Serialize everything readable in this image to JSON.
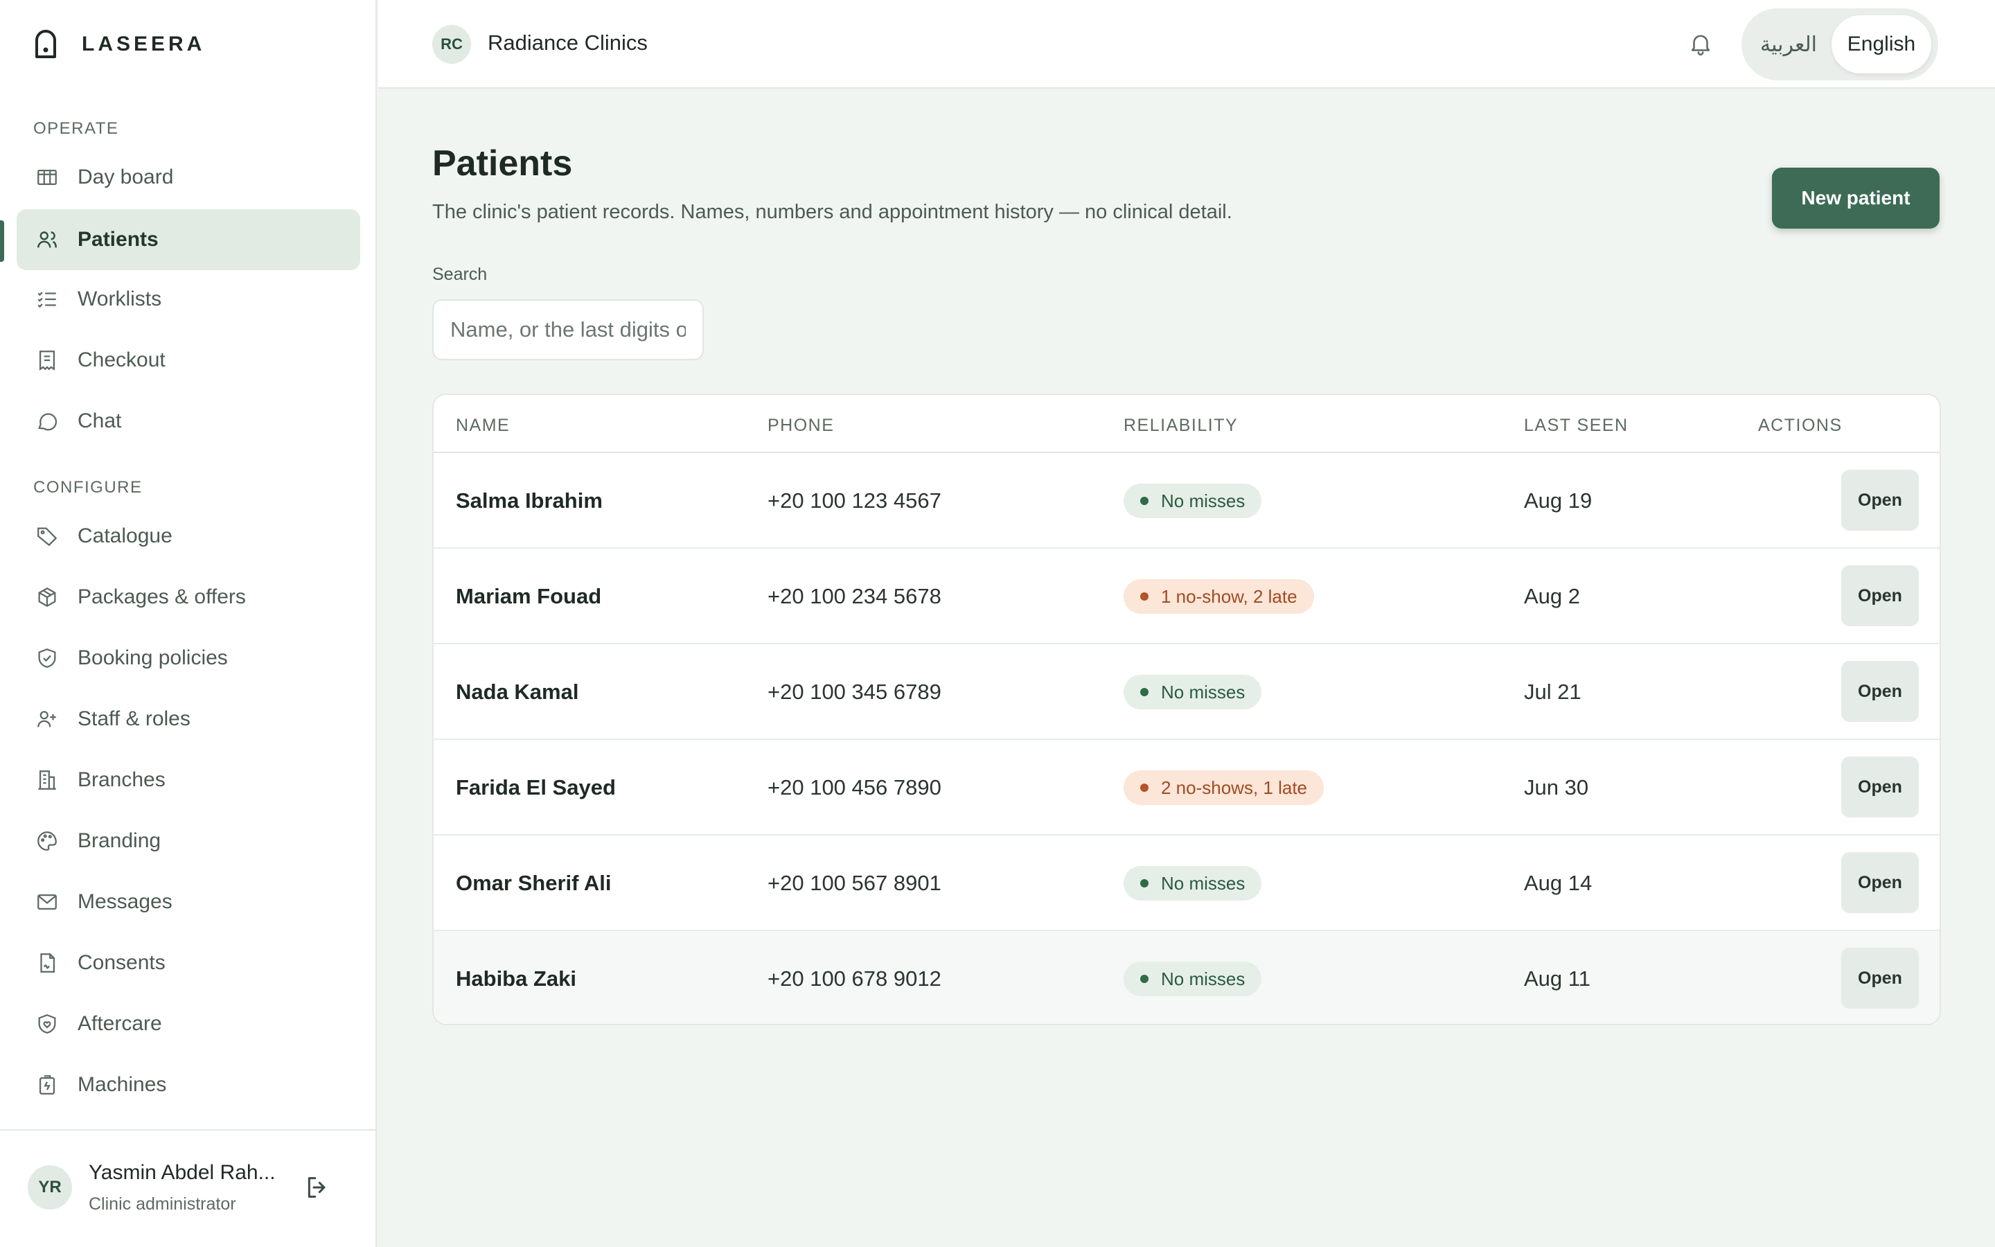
{
  "brand": {
    "name": "LASEERA"
  },
  "sidebar": {
    "sections": [
      {
        "label": "OPERATE",
        "items": [
          {
            "label": "Day board",
            "icon": "board-icon"
          },
          {
            "label": "Patients",
            "icon": "users-icon",
            "active": true
          },
          {
            "label": "Worklists",
            "icon": "list-check-icon"
          },
          {
            "label": "Checkout",
            "icon": "receipt-icon"
          },
          {
            "label": "Chat",
            "icon": "chat-icon"
          }
        ]
      },
      {
        "label": "CONFIGURE",
        "items": [
          {
            "label": "Catalogue",
            "icon": "tag-icon"
          },
          {
            "label": "Packages & offers",
            "icon": "package-icon"
          },
          {
            "label": "Booking policies",
            "icon": "shield-check-icon"
          },
          {
            "label": "Staff & roles",
            "icon": "user-plus-icon"
          },
          {
            "label": "Branches",
            "icon": "building-icon"
          },
          {
            "label": "Branding",
            "icon": "palette-icon"
          },
          {
            "label": "Messages",
            "icon": "mail-icon"
          },
          {
            "label": "Consents",
            "icon": "file-signature-icon"
          },
          {
            "label": "Aftercare",
            "icon": "heart-shield-icon"
          },
          {
            "label": "Machines",
            "icon": "laser-machine-icon"
          }
        ]
      }
    ],
    "user": {
      "initials": "YR",
      "name": "Yasmin Abdel Rah...",
      "role": "Clinic administrator"
    }
  },
  "topbar": {
    "clinic_initials": "RC",
    "clinic_name": "Radiance Clinics",
    "languages": {
      "arabic": "العربية",
      "english": "English",
      "selected": "English"
    }
  },
  "main": {
    "title": "Patients",
    "subtitle": "The clinic's patient records. Names, numbers and appointment history — no clinical detail.",
    "new_button": "New patient",
    "search": {
      "label": "Search",
      "placeholder": "Name, or the last digits of a phone",
      "value": ""
    },
    "table": {
      "columns": [
        "NAME",
        "PHONE",
        "RELIABILITY",
        "LAST SEEN",
        "ACTIONS"
      ],
      "action_label": "Open",
      "rows": [
        {
          "name": "Salma Ibrahim",
          "phone": "+20 100 123 4567",
          "reliability": "No misses",
          "status": "good",
          "last_seen": "Aug 19"
        },
        {
          "name": "Mariam Fouad",
          "phone": "+20 100 234 5678",
          "reliability": "1 no-show, 2 late",
          "status": "warn",
          "last_seen": "Aug 2"
        },
        {
          "name": "Nada Kamal",
          "phone": "+20 100 345 6789",
          "reliability": "No misses",
          "status": "good",
          "last_seen": "Jul 21"
        },
        {
          "name": "Farida El Sayed",
          "phone": "+20 100 456 7890",
          "reliability": "2 no-shows, 1 late",
          "status": "warn",
          "last_seen": "Jun 30"
        },
        {
          "name": "Omar Sherif Ali",
          "phone": "+20 100 567 8901",
          "reliability": "No misses",
          "status": "good",
          "last_seen": "Aug 14"
        },
        {
          "name": "Habiba Zaki",
          "phone": "+20 100 678 9012",
          "reliability": "No misses",
          "status": "good",
          "last_seen": "Aug 11"
        }
      ]
    }
  },
  "colors": {
    "accent": "#3d6b56",
    "background": "#f1f5f2",
    "good_badge": "#e5efe8",
    "warn_badge": "#fbe6d8"
  }
}
